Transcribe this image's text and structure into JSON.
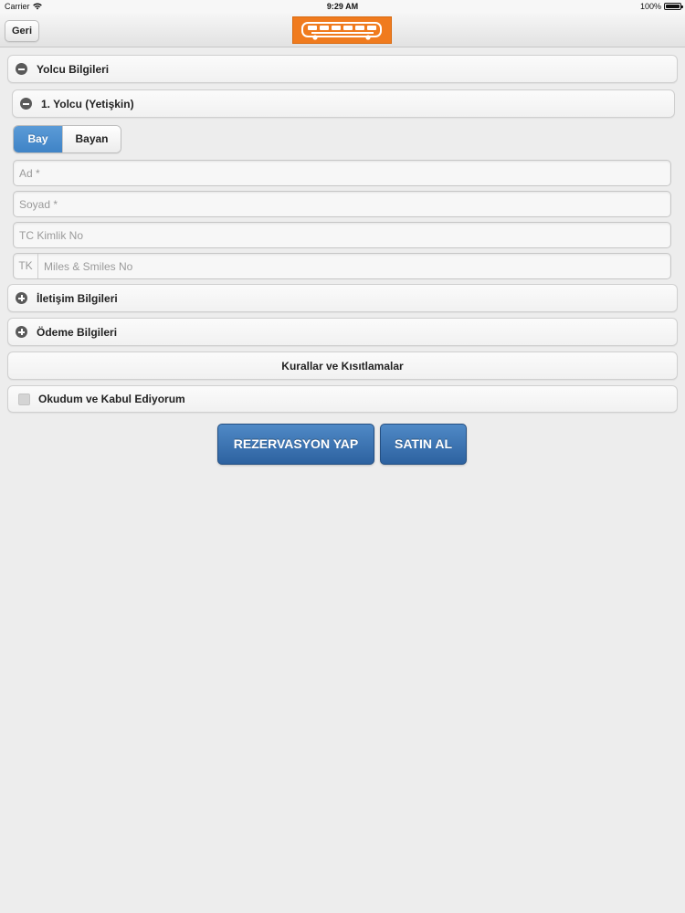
{
  "status_bar": {
    "carrier": "Carrier",
    "time": "9:29 AM",
    "battery": "100%",
    "battery_level_fraction": 1.0
  },
  "header": {
    "back_label": "Geri",
    "logo_icon": "bus-logo-icon",
    "logo_color": "#f07b1e"
  },
  "sections": {
    "passenger_info": {
      "label": "Yolcu Bilgileri",
      "icon": "minus-circle-icon"
    },
    "passenger_1": {
      "label": "1. Yolcu (Yetişkin)",
      "icon": "minus-circle-icon"
    },
    "contact_info": {
      "label": "İletişim Bilgileri",
      "icon": "plus-circle-icon"
    },
    "payment_info": {
      "label": "Ödeme Bilgileri",
      "icon": "plus-circle-icon"
    },
    "rules": {
      "label": "Kurallar ve Kısıtlamalar"
    },
    "accept": {
      "label": "Okudum ve Kabul Ediyorum",
      "checked": false
    }
  },
  "gender": {
    "options": [
      "Bay",
      "Bayan"
    ],
    "selected": "Bay",
    "active_color": "#4a8ccf"
  },
  "fields": {
    "first_name": {
      "placeholder": "Ad *",
      "value": ""
    },
    "last_name": {
      "placeholder": "Soyad *",
      "value": ""
    },
    "tc_id": {
      "placeholder": "TC Kimlik No",
      "value": ""
    },
    "miles": {
      "prefix": "TK",
      "placeholder": "Miles & Smiles No",
      "value": ""
    }
  },
  "actions": {
    "reserve_label": "REZERVASYON YAP",
    "buy_label": "SATIN AL",
    "button_color": "#3a72b3"
  }
}
